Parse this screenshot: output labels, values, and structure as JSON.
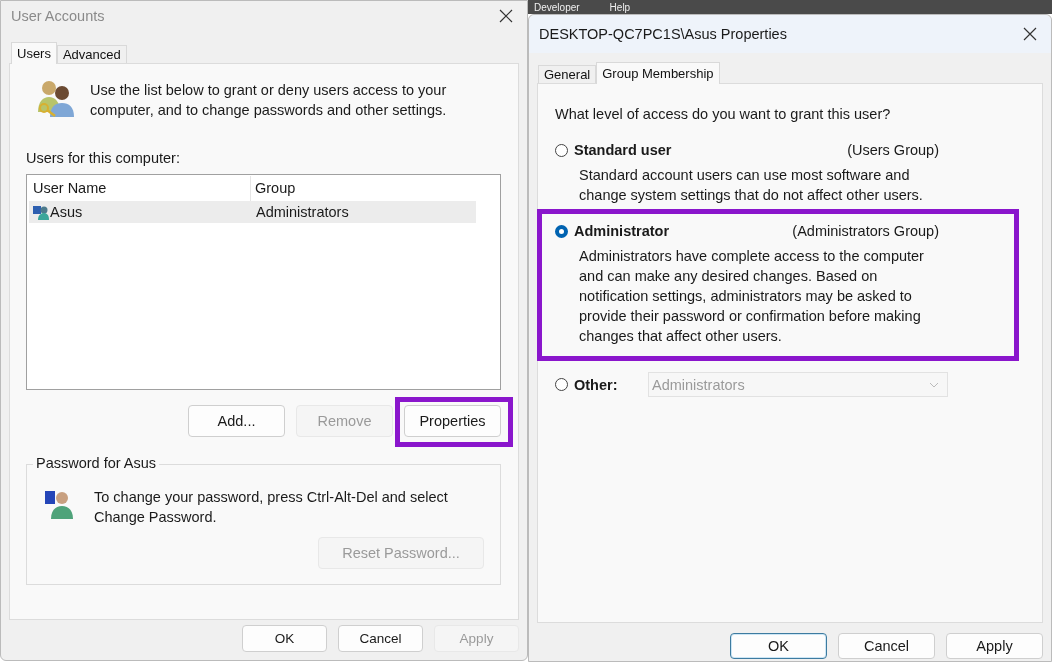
{
  "background_menu": [
    "Developer",
    "Help"
  ],
  "user_accounts": {
    "title": "User Accounts",
    "tabs": [
      {
        "label": "Users",
        "selected": true
      },
      {
        "label": "Advanced",
        "selected": false
      }
    ],
    "intro": "Use the list below to grant or deny users access to your computer, and to change passwords and other settings.",
    "list_label": "Users for this computer:",
    "columns": [
      "User Name",
      "Group"
    ],
    "rows": [
      {
        "cells": [
          "Asus",
          "Administrators"
        ],
        "selected": true
      }
    ],
    "buttons": [
      {
        "label": "Add...",
        "disabled": false,
        "highlighted": false
      },
      {
        "label": "Remove",
        "disabled": true,
        "highlighted": false
      },
      {
        "label": "Properties",
        "disabled": false,
        "highlighted": true
      }
    ],
    "password_group": {
      "title": "Password for Asus",
      "text": "To change your password, press Ctrl-Alt-Del and select Change Password.",
      "button": {
        "label": "Reset Password...",
        "disabled": true
      }
    },
    "footer_buttons": [
      {
        "label": "OK",
        "disabled": false,
        "default": false
      },
      {
        "label": "Cancel",
        "disabled": false,
        "default": false
      },
      {
        "label": "Apply",
        "disabled": true,
        "default": false
      }
    ]
  },
  "properties": {
    "title": "DESKTOP-QC7PC1S\\Asus Properties",
    "tabs": [
      {
        "label": "General",
        "selected": false
      },
      {
        "label": "Group Membership",
        "selected": true
      }
    ],
    "question": "What level of access do you want to grant this user?",
    "options": [
      {
        "kind": "radio",
        "label": "Standard user",
        "group": "(Users Group)",
        "description": "Standard account users can use most software and change system settings that do not affect other users.",
        "selected": false,
        "highlighted": false
      },
      {
        "kind": "radio",
        "label": "Administrator",
        "group": "(Administrators Group)",
        "description": "Administrators have complete access to the computer and can make any desired changes. Based on notification settings, administrators may be asked to provide their password or confirmation before making changes that affect other users.",
        "selected": true,
        "highlighted": true
      },
      {
        "kind": "dropdown",
        "label": "Other:",
        "value": "Administrators",
        "selected": false,
        "disabled": true,
        "highlighted": false
      }
    ],
    "footer_buttons": [
      {
        "label": "OK",
        "disabled": false,
        "default": true
      },
      {
        "label": "Cancel",
        "disabled": false,
        "default": false
      },
      {
        "label": "Apply",
        "disabled": false,
        "default": false
      }
    ]
  }
}
